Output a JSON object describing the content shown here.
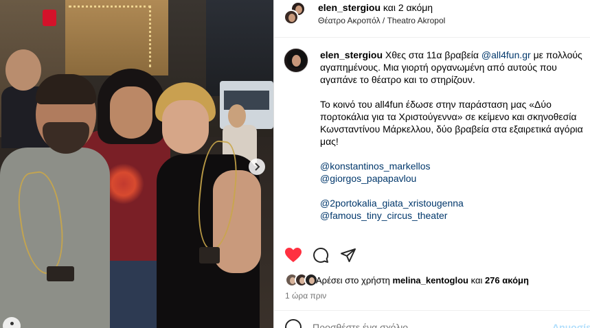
{
  "post": {
    "header": {
      "username": "elen_stergiou",
      "coauthors": "και 2 ακόμη",
      "location": "Θέατρο Ακροπόλ / Theatro Akropol"
    },
    "caption": {
      "username": "elen_stergiou",
      "line1_pre": "Χθες στα 11α βραβεία ",
      "line1_link": "@all4fun.gr",
      "line1_post": " με πολλούς",
      "line2": "αγαπημένους. Μια γιορτή οργανωμένη από αυτούς που",
      "line3": "αγαπάνε το θέατρο και το στηρίζουν.",
      "line4": "Το κοινό του all4fun έδωσε στην παράσταση μας «Δύο",
      "line5": "πορτοκάλια για τα Χριστούγεννα» σε κείμενο και σκηνοθεσία",
      "line6": "Κωνσταντίνου Μάρκελλου, δύο βραβεία στα εξαιρετικά αγόρια",
      "line7": "μας!",
      "mentions": [
        "@konstantinos_markellos",
        "@giorgos_papapavlou",
        "@2portokalia_giata_xristougenna",
        "@famous_tiny_circus_theater"
      ]
    },
    "actions": {
      "like_icon": "heart-icon",
      "comment_icon": "comment-icon",
      "share_icon": "paper-plane-icon",
      "like_color": "#ff3040"
    },
    "likes": {
      "prefix": "Αρέσει στο χρήστη ",
      "user": "melina_kentoglou",
      "middle": " και ",
      "count": "276 ακόμη"
    },
    "timestamp": "1 ώρα πριν",
    "comment_box": {
      "placeholder": "Προσθέστε ένα σχόλιο...",
      "post_label": "Δημοσίευση"
    },
    "carousel": {
      "next_icon": "chevron-right-icon"
    }
  }
}
